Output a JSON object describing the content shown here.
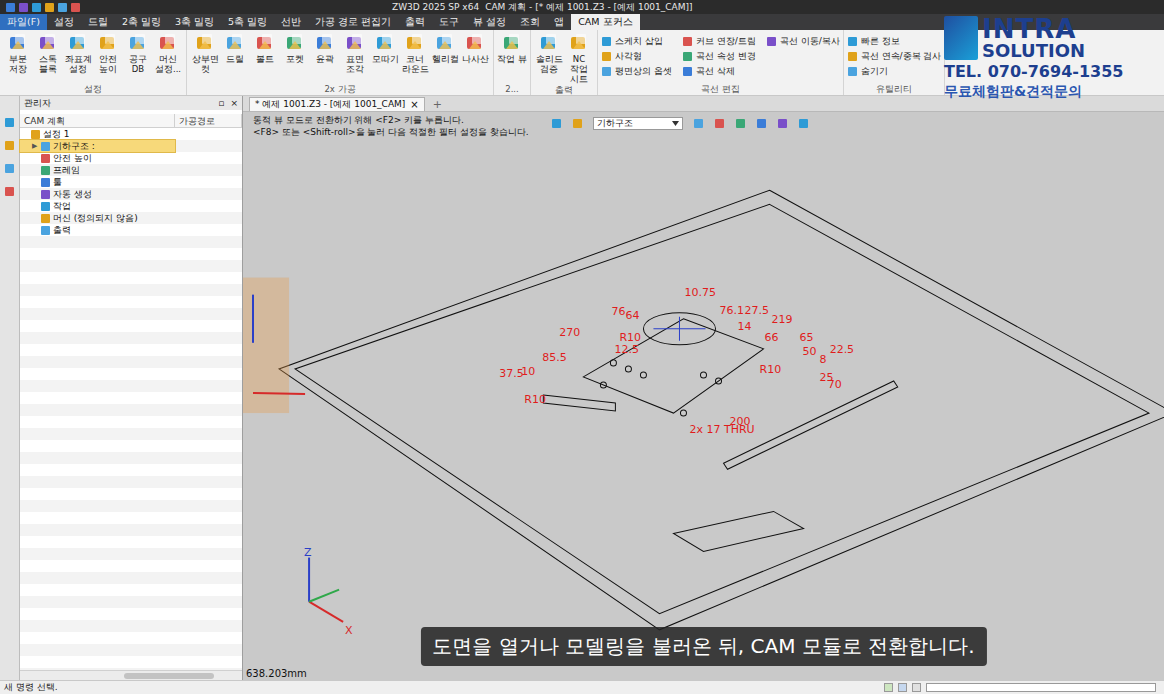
{
  "window": {
    "title": "ZW3D 2025 SP x64",
    "document_title": "CAM 계획 - [* 예제 1001.Z3 - [예제 1001_CAM]]"
  },
  "menu_tabs": [
    {
      "label": "파일(F)",
      "selected": false,
      "kind": "file"
    },
    {
      "label": "설정",
      "selected": false,
      "kind": "tab"
    },
    {
      "label": "드릴",
      "selected": false,
      "kind": "tab"
    },
    {
      "label": "2축 밀링",
      "selected": false,
      "kind": "tab"
    },
    {
      "label": "3축 밀링",
      "selected": false,
      "kind": "tab"
    },
    {
      "label": "5축 밀링",
      "selected": false,
      "kind": "tab"
    },
    {
      "label": "선반",
      "selected": false,
      "kind": "tab"
    },
    {
      "label": "가공 경로 편집기",
      "selected": false,
      "kind": "tab"
    },
    {
      "label": "출력",
      "selected": false,
      "kind": "tab"
    },
    {
      "label": "도구",
      "selected": false,
      "kind": "tab"
    },
    {
      "label": "뷰 설정",
      "selected": false,
      "kind": "tab"
    },
    {
      "label": "조회",
      "selected": false,
      "kind": "tab"
    },
    {
      "label": "앱",
      "selected": false,
      "kind": "tab"
    },
    {
      "label": "CAM 포커스",
      "selected": true,
      "kind": "tab"
    }
  ],
  "ribbon": {
    "groups": [
      {
        "label": "설정",
        "kind": "large",
        "buttons": [
          "부분 저장",
          "스톡 블록",
          "좌표계 설정",
          "안전 높이",
          "공구 DB",
          "머신 설정..."
        ]
      },
      {
        "label": "2x 가공",
        "kind": "large",
        "buttons": [
          "상부면 컷",
          "드릴",
          "볼트",
          "포켓",
          "윤곽",
          "표면 조각",
          "모따기",
          "코너 라운드",
          "헬리컬",
          "나사산"
        ]
      },
      {
        "label": "2...",
        "kind": "large",
        "buttons": [
          "작업 뷰"
        ]
      },
      {
        "label": "출력",
        "kind": "large",
        "buttons": [
          "솔리드 검증",
          "NC 작업 시트"
        ]
      },
      {
        "label": "곡선 편집",
        "kind": "small",
        "buttons": [
          "스케치 삽입",
          "사각형",
          "평면상의 옵셋",
          "커브 연장/트림",
          "곡선 속성 변경",
          "곡선 삭제",
          "곡선 이동/복사"
        ]
      },
      {
        "label": "유틸리티",
        "kind": "small",
        "buttons": [
          "빠른 정보",
          "곡선 연속/중복 검사",
          "숨기기"
        ]
      }
    ]
  },
  "watermark": {
    "brand_top": "INTRA",
    "brand_bottom": "SOLUTION",
    "phone": "TEL. 070-7694-1355",
    "cta": "무료체험판&견적문의"
  },
  "manager": {
    "title": "관리자",
    "controls": [
      "▫",
      "×"
    ],
    "columns": [
      "CAM 계획",
      "가공경로"
    ],
    "items": [
      {
        "label": "설정 1",
        "depth": 0,
        "selected": false,
        "expandable": false
      },
      {
        "label": "기하구조 :",
        "depth": 1,
        "selected": true,
        "expandable": true
      },
      {
        "label": "안전 높이",
        "depth": 1,
        "selected": false,
        "expandable": false
      },
      {
        "label": "프레임",
        "depth": 1,
        "selected": false,
        "expandable": false
      },
      {
        "label": "툴",
        "depth": 1,
        "selected": false,
        "expandable": false
      },
      {
        "label": "자동 생성",
        "depth": 1,
        "selected": false,
        "expandable": false
      },
      {
        "label": "작업",
        "depth": 1,
        "selected": false,
        "expandable": false
      },
      {
        "label": "머신 (정의되지 않음)",
        "depth": 1,
        "selected": false,
        "expandable": false
      },
      {
        "label": "출력",
        "depth": 1,
        "selected": false,
        "expandable": false
      }
    ]
  },
  "doc_tabs": {
    "items": [
      {
        "label": "* 예제 1001.Z3 - [예제 1001_CAM]",
        "selected": true,
        "close": "×"
      }
    ],
    "add": "+"
  },
  "viewport": {
    "hints": [
      "동적 뷰 모드로 전환하기 위해 <F2> 키를 누릅니다.",
      "<F8> 또는 <Shift-roll>을 눌러 다음 적절한 필터 설정을 찾습니다."
    ],
    "filter": "기하구조",
    "dimensions": [
      "10.75",
      "76",
      "64",
      "76.1",
      "27.5",
      "14",
      "219",
      "66",
      "65",
      "50",
      "22.5",
      "8",
      "270",
      "R10",
      "12.5",
      "85.5",
      "R10",
      "25",
      "70",
      "37.5",
      "10",
      "R10",
      "200",
      "2x 17 THRU"
    ],
    "axis_labels": [
      "Z",
      "X"
    ],
    "subtitle": "도면을 열거나 모델링을 불러온 뒤, CAM 모듈로 전환합니다.",
    "measure": "638.203mm"
  },
  "status_bar": {
    "text": "새 명령 선택."
  }
}
